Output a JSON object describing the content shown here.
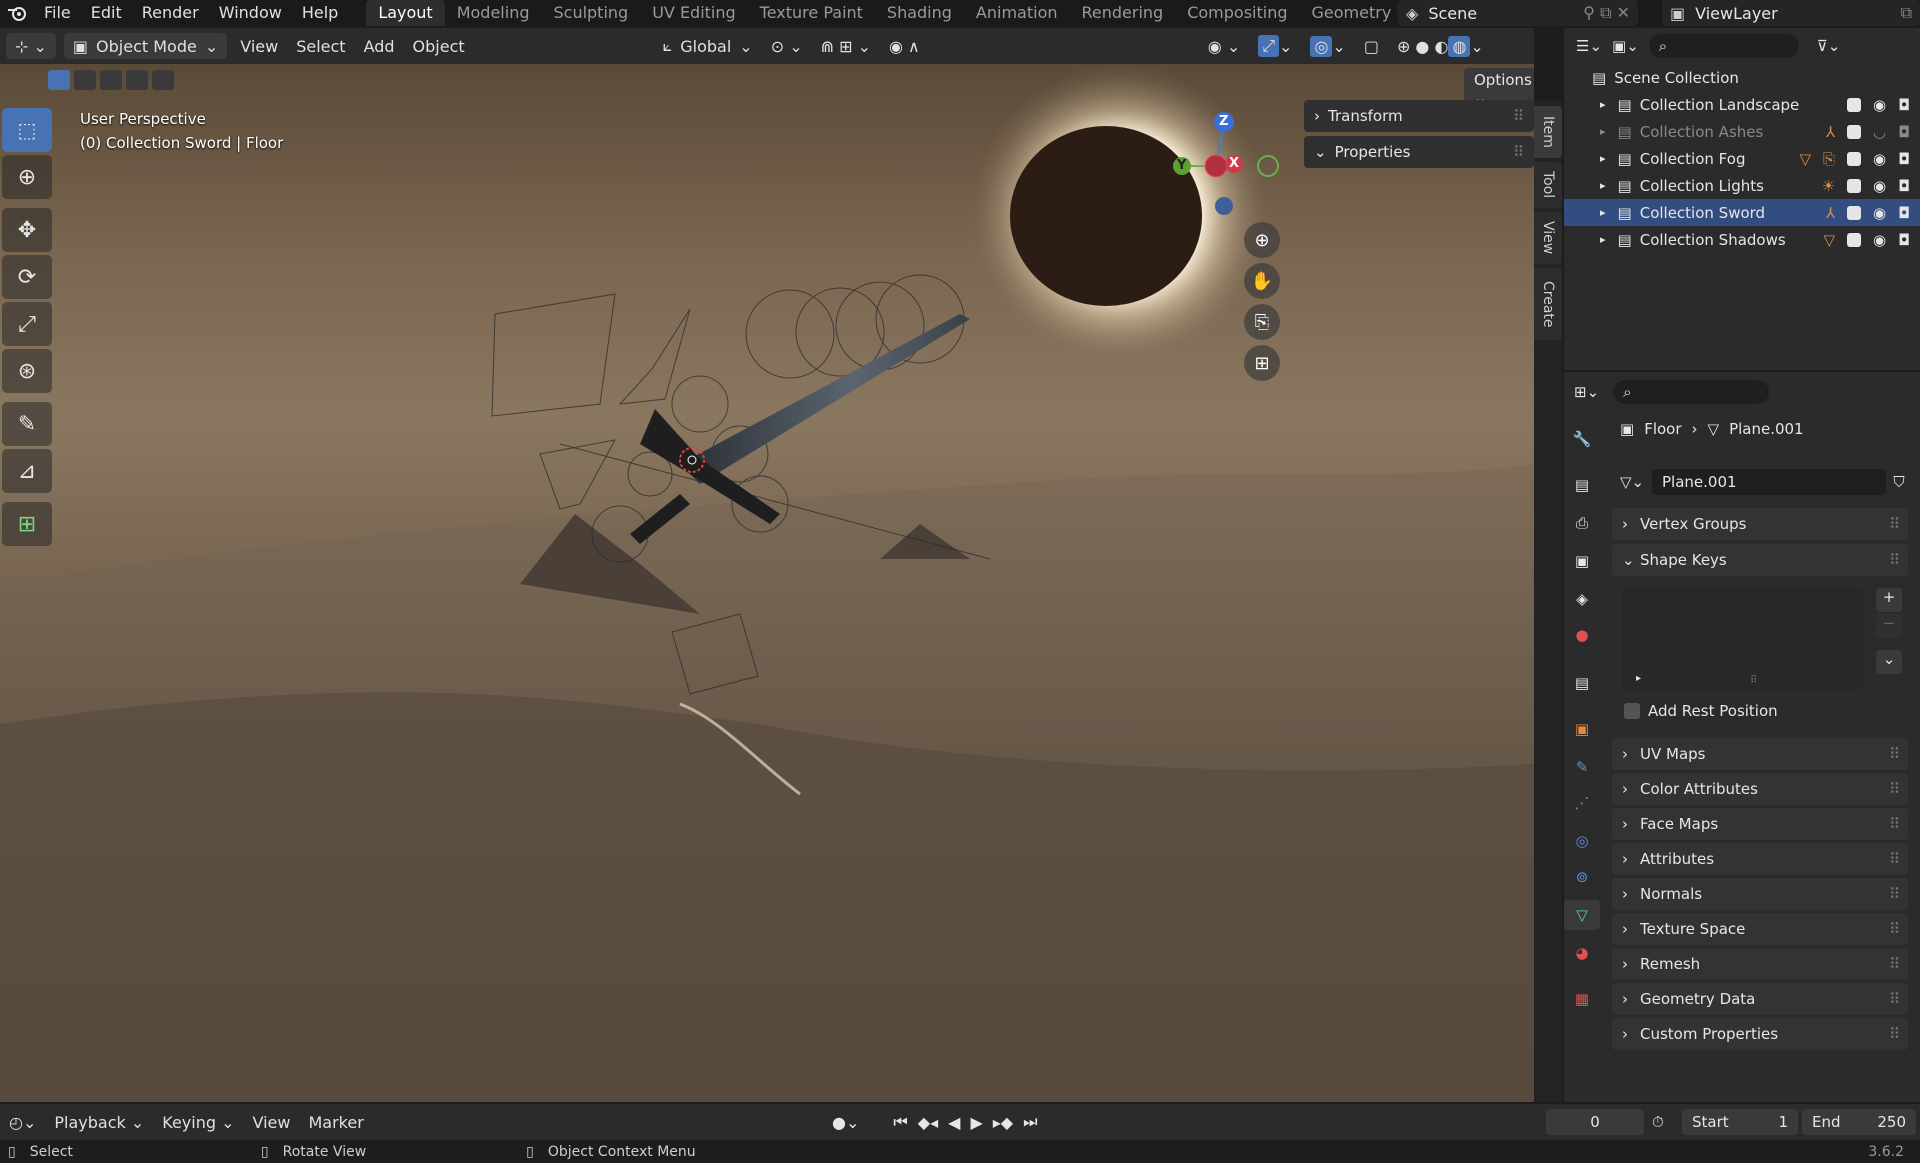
{
  "top_menu": {
    "items": [
      "File",
      "Edit",
      "Render",
      "Window",
      "Help"
    ],
    "workspaces": [
      "Layout",
      "Modeling",
      "Sculpting",
      "UV Editing",
      "Texture Paint",
      "Shading",
      "Animation",
      "Rendering",
      "Compositing",
      "Geometry Nodes"
    ],
    "scene": "Scene",
    "view_layer": "ViewLayer"
  },
  "viewport_header": {
    "mode": "Object Mode",
    "menus": [
      "View",
      "Select",
      "Add",
      "Object"
    ],
    "orientation": "Global",
    "options": "Options"
  },
  "viewport": {
    "perspective": "User Perspective",
    "context": "(0) Collection Sword | Floor",
    "npanel_transform": "Transform",
    "npanel_properties": "Properties",
    "vtabs": [
      "Item",
      "Tool",
      "View",
      "Create"
    ],
    "gizmo": {
      "z": "Z",
      "x": "X",
      "y": "Y"
    }
  },
  "outliner": {
    "root": "Scene Collection",
    "collections": [
      {
        "name": "Collection Landscape"
      },
      {
        "name": "Collection Ashes"
      },
      {
        "name": "Collection Fog"
      },
      {
        "name": "Collection Lights"
      },
      {
        "name": "Collection Sword"
      },
      {
        "name": "Collection Shadows"
      }
    ]
  },
  "properties": {
    "object": "Floor",
    "mesh": "Plane.001",
    "mesh_field": "Plane.001",
    "panels": [
      "Vertex Groups",
      "Shape Keys",
      "UV Maps",
      "Color Attributes",
      "Face Maps",
      "Attributes",
      "Normals",
      "Texture Space",
      "Remesh",
      "Geometry Data",
      "Custom Properties"
    ],
    "add_rest_position": "Add Rest Position"
  },
  "timeline": {
    "menus": [
      "Playback",
      "Keying",
      "View",
      "Marker"
    ],
    "current_frame": "0",
    "start_label": "Start",
    "start_value": "1",
    "end_label": "End",
    "end_value": "250"
  },
  "statusbar": {
    "select": "Select",
    "rotate": "Rotate View",
    "context_menu": "Object Context Menu",
    "version": "3.6.2"
  },
  "colors": {
    "accent": "#4772b3",
    "selection": "#334d80"
  }
}
